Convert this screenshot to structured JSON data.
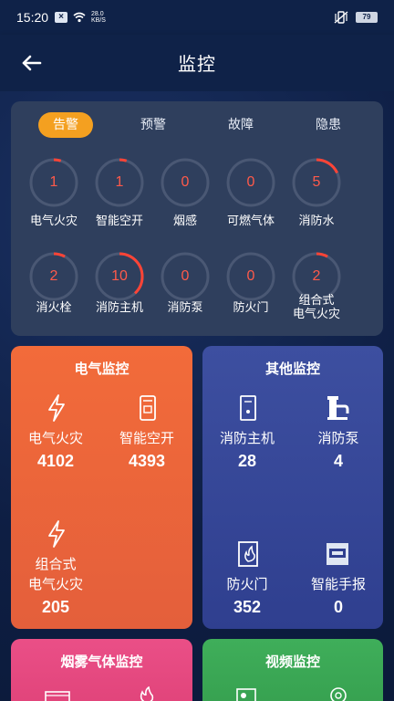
{
  "status": {
    "time": "15:20",
    "speed_top": "28.0",
    "speed_bottom": "KB/S",
    "battery": "79"
  },
  "header": {
    "title": "监控"
  },
  "alarm": {
    "tabs": [
      {
        "label": "告警",
        "active": true
      },
      {
        "label": "预警",
        "active": false
      },
      {
        "label": "故障",
        "active": false
      },
      {
        "label": "隐患",
        "active": false
      }
    ],
    "items": [
      {
        "label": "电气火灾",
        "value": "1",
        "fraction": 0.05
      },
      {
        "label": "智能空开",
        "value": "1",
        "fraction": 0.05
      },
      {
        "label": "烟感",
        "value": "0",
        "fraction": 0
      },
      {
        "label": "可燃气体",
        "value": "0",
        "fraction": 0
      },
      {
        "label": "消防水",
        "value": "5",
        "fraction": 0.18
      },
      {
        "label": "消火栓",
        "value": "2",
        "fraction": 0.08
      },
      {
        "label": "消防主机",
        "value": "10",
        "fraction": 0.38
      },
      {
        "label": "消防泵",
        "value": "0",
        "fraction": 0
      },
      {
        "label": "防火门",
        "value": "0",
        "fraction": 0
      },
      {
        "label": "组合式\n电气火灾",
        "value": "2",
        "fraction": 0.08
      }
    ]
  },
  "electric": {
    "title": "电气监控",
    "items": [
      {
        "label": "电气火灾",
        "value": "4102",
        "icon": "lightning-icon"
      },
      {
        "label": "智能空开",
        "value": "4393",
        "icon": "smart-breaker-icon"
      },
      {
        "label": "组合式\n电气火灾",
        "value": "205",
        "icon": "lightning-icon"
      }
    ]
  },
  "other": {
    "title": "其他监控",
    "items": [
      {
        "label": "消防主机",
        "value": "28",
        "icon": "fire-host-icon"
      },
      {
        "label": "消防泵",
        "value": "4",
        "icon": "fire-pump-icon"
      },
      {
        "label": "防火门",
        "value": "352",
        "icon": "fire-door-icon"
      },
      {
        "label": "智能手报",
        "value": "0",
        "icon": "manual-alarm-icon"
      }
    ]
  },
  "smoke": {
    "title": "烟雾气体监控"
  },
  "video": {
    "title": "视频监控"
  },
  "colors": {
    "accent": "#f4a020",
    "alarm_red": "#ff5a4a",
    "electric_top": "#f26b3a",
    "other_top": "#3d4fa0",
    "smoke_top": "#ea4f87",
    "video_top": "#3fae5a"
  }
}
